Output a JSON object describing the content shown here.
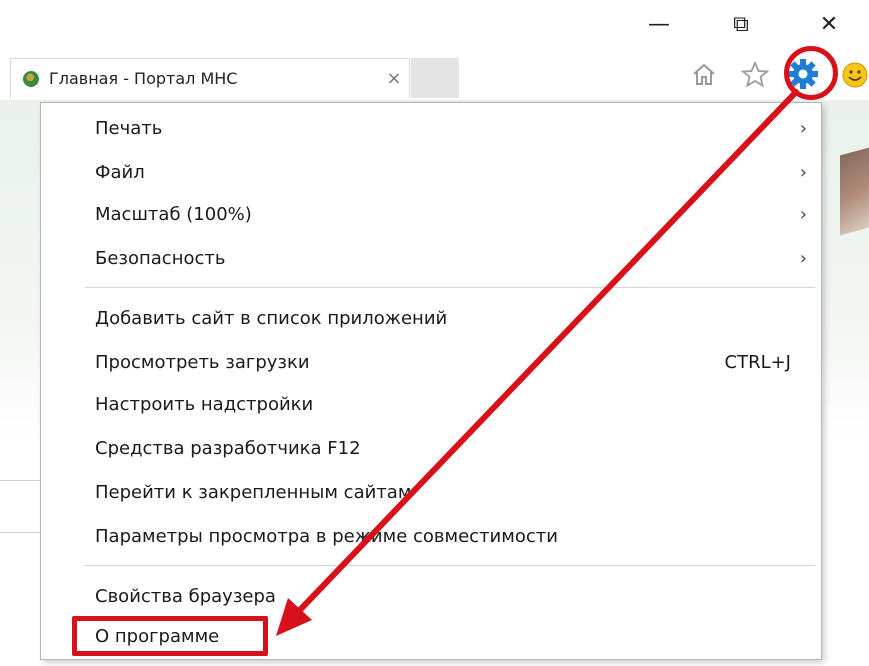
{
  "window": {
    "minimize_glyph": "—",
    "restore_glyph": "⧉",
    "close_glyph": "✕"
  },
  "tab": {
    "title": "Главная - Портал МНС",
    "close_glyph": "×"
  },
  "toolbar": {
    "icons": [
      "home-icon",
      "favorites-star-icon",
      "gear-icon",
      "smiley-icon"
    ]
  },
  "menu": {
    "group1": [
      {
        "label": "Печать",
        "chevron": "›"
      },
      {
        "label": "Файл",
        "chevron": "›"
      },
      {
        "label": "Масштаб (100%)",
        "chevron": "›"
      },
      {
        "label": "Безопасность",
        "chevron": "›"
      }
    ],
    "group2": [
      {
        "label": "Добавить сайт в список приложений"
      },
      {
        "label": "Просмотреть загрузки",
        "shortcut": "CTRL+J"
      },
      {
        "label": "Настроить надстройки"
      },
      {
        "label": "Средства разработчика F12"
      },
      {
        "label": "Перейти к закрепленным сайтам"
      },
      {
        "label": "Параметры просмотра в режиме совместимости"
      }
    ],
    "group3": [
      {
        "label": "Свойства браузера"
      },
      {
        "label": "О программе"
      }
    ]
  },
  "annotation": {
    "color": "#d8101a"
  }
}
